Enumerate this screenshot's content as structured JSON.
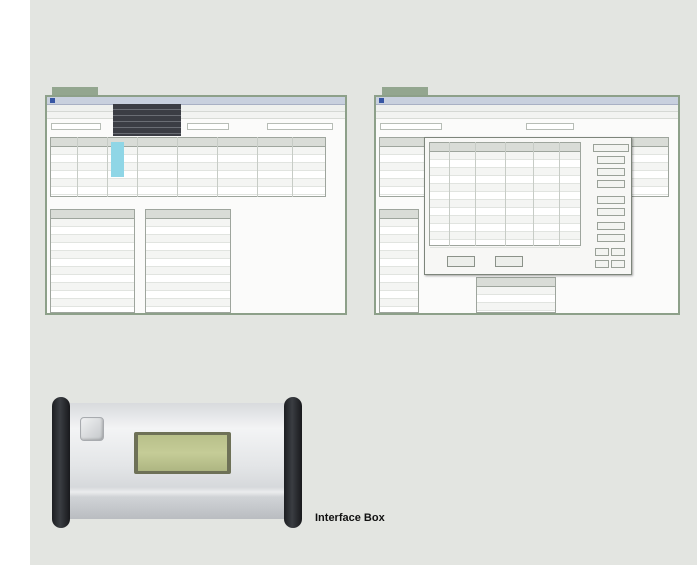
{
  "caption": "Interface Box",
  "colors": {
    "panel_background": "#e3e5e1",
    "frame_border": "#8da089",
    "tab_flag": "#93a68f",
    "lcd_screen": "#c5cc97",
    "device_endcap": "#2b2d31",
    "highlight_column": "#8fd6e6"
  },
  "images": [
    "software-screenshot-data-table",
    "software-screenshot-dialog",
    "interface-box-photo"
  ]
}
